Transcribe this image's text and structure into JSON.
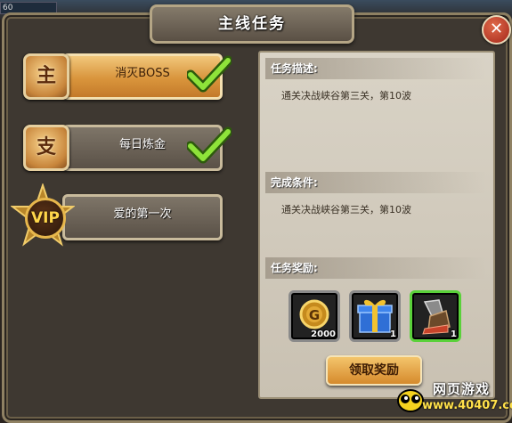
{
  "hud": {
    "level": "60"
  },
  "window": {
    "title": "主线任务"
  },
  "quests": [
    {
      "badge": "主",
      "name": "消灭BOSS",
      "done": true
    },
    {
      "badge": "支",
      "name": "每日炼金",
      "done": true
    },
    {
      "badge": "VIP",
      "name": "爱的第一次",
      "done": false
    }
  ],
  "details": {
    "description_label": "任务描述:",
    "description": "通关决战峡谷第三关，第10波",
    "condition_label": "完成条件:",
    "condition": "通关决战峡谷第三关，第10波",
    "reward_label": "任务奖励:"
  },
  "rewards": [
    {
      "icon": "gold-coin-icon",
      "count": "2000"
    },
    {
      "icon": "gift-box-icon",
      "count": "1"
    },
    {
      "icon": "armor-item-icon",
      "count": "1"
    }
  ],
  "claim_button": "领取奖励",
  "watermark": {
    "line1": "网页游戏",
    "line2": "www.40407.com"
  },
  "colors": {
    "accent": "#d9953c",
    "check_green": "#6fc61f",
    "reward_green": "#5ad13a"
  }
}
